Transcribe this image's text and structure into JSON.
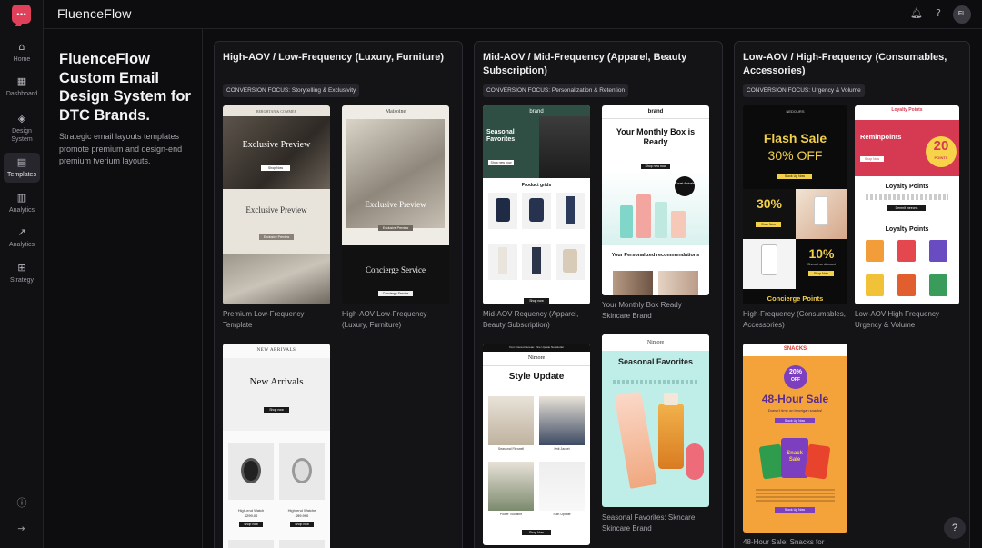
{
  "app": {
    "title": "FluenceFlow",
    "avatar": "FL"
  },
  "sidebar": {
    "items": [
      {
        "label": "Home",
        "icon": "home-icon"
      },
      {
        "label": "Dashboard",
        "icon": "grid-icon"
      },
      {
        "label": "Design System",
        "icon": "layers-icon"
      },
      {
        "label": "Templates",
        "icon": "folder-icon"
      },
      {
        "label": "Analytics",
        "icon": "bar-chart-icon"
      },
      {
        "label": "Analytics",
        "icon": "line-chart-icon"
      },
      {
        "label": "Strategy",
        "icon": "strategy-icon"
      }
    ]
  },
  "intro": {
    "title": "FluenceFlow Custom Email Design System for DTC Brands.",
    "description": "Strategic email layouts templates promote premium and design-end premium tverium layouts."
  },
  "columns": [
    {
      "title": "High-AOV / Low-Frequency (Luxury, Furniture)",
      "focus": "CONVERSION FOCUS: Storytelling & Exclusivity",
      "cards": [
        {
          "caption": "Premium Low-Frequency Template"
        },
        {
          "caption": "High-AOV Low-Frequency (Luxury, Furniture)"
        },
        {
          "caption": ""
        }
      ]
    },
    {
      "title": "Mid-AOV / Mid-Frequency (Apparel, Beauty Subscription)",
      "focus": "CONVERSION FOCUS: Personalization & Retention",
      "cards": [
        {
          "caption": "Mid-AOV Requency (Apparel, Beauty Subscription)"
        },
        {
          "caption": "Your Monthly Box Ready Skincare Brand"
        },
        {
          "caption": ""
        },
        {
          "caption": "Seasonal Favorites: Skncare Skincare Brand"
        }
      ]
    },
    {
      "title": "Low-AOV / High-Frequency (Consumables, Accessories)",
      "focus": "CONVERSION FOCUS: Urgency & Volume",
      "cards": [
        {
          "caption": "High-Frequency (Consumables, Accessories)"
        },
        {
          "caption": "Low-AOV High Frequency Urgency & Volume"
        },
        {
          "caption": "48-Hour Sale: Snacks for"
        }
      ]
    }
  ],
  "emails": {
    "lux1": {
      "brand": "BERGHTAN & COMMER",
      "headline": "Exclusive Preview",
      "cta": "Shop Now",
      "headline2": "Exclusive Preview",
      "cta2": "Exclusive Preview"
    },
    "lux2": {
      "brand": "Maisoine",
      "headline": "Exclusive Preview",
      "cta": "Exclusive Preview",
      "headline2": "Concierge Service",
      "cta2": "Concierge Service"
    },
    "lux3": {
      "brand": "NEW ARRIVALS",
      "headline": "New Arrivals",
      "cta": "Shop now",
      "item1": "High-end Watch",
      "price1": "$299.00",
      "item2": "High-end Watche",
      "price2": "$99.990",
      "btn": "Shop now"
    },
    "mid1": {
      "brand": "brand",
      "headline": "Seasonal Favorites",
      "cta": "Shop new now",
      "section": "Product grids",
      "cta2": "Shop now"
    },
    "mid2": {
      "brand": "brand",
      "headline": "Your Monthly Box is Ready",
      "cta": "Shop new now",
      "sticker": "Covet Arrivals",
      "section": "Your Personalized recommendations"
    },
    "mid3": {
      "topline": "Your Interest Bureau: Zine Update Newsletter",
      "brand": "Nimore",
      "headline": "Style Update",
      "item1": "Seasonal Flexwell",
      "item2": "Knit Jacket",
      "item3": "Power Vuolaine",
      "item4": "Shin Update",
      "cta": "Shop Now"
    },
    "mid4": {
      "brand": "Nimore",
      "headline": "Seasonal Favorites"
    },
    "low1": {
      "brand": "NEDOURS",
      "headline": "Flash Sale",
      "discount": "30% OFF",
      "cta": "Stock Up Now",
      "pct1": "30%",
      "cta2": "Grab Now",
      "pct2": "10%",
      "sub2": "Shmoot so discount",
      "cta3": "Shop Now",
      "footer": "Concierge Points"
    },
    "low2": {
      "brand": "Loyalty Points",
      "headline": "Reminpoints",
      "points": "20",
      "points_label": "POINTS",
      "cta": "Shop Now",
      "section": "Loyalty Points",
      "cta2": "Denrnit meeons",
      "section2": "Loyalty Points"
    },
    "low3": {
      "brand": "SNACKS",
      "badge_pct": "20%",
      "badge_off": "OFF",
      "headline": "48-Hour Sale",
      "sub": "Doesn't time on bwcrigan snacks!",
      "cta": "Stock Up Now",
      "cta2": "Stock Up Now",
      "bag": "Snack Sale"
    }
  },
  "colors": {
    "accent": "#e0405a",
    "background": "#0d0d0f",
    "flash_sale_yellow": "#f2d04a",
    "loyalty_red": "#d63a52",
    "snack_orange": "#f3a33a",
    "snack_purple": "#7b3fbf"
  }
}
